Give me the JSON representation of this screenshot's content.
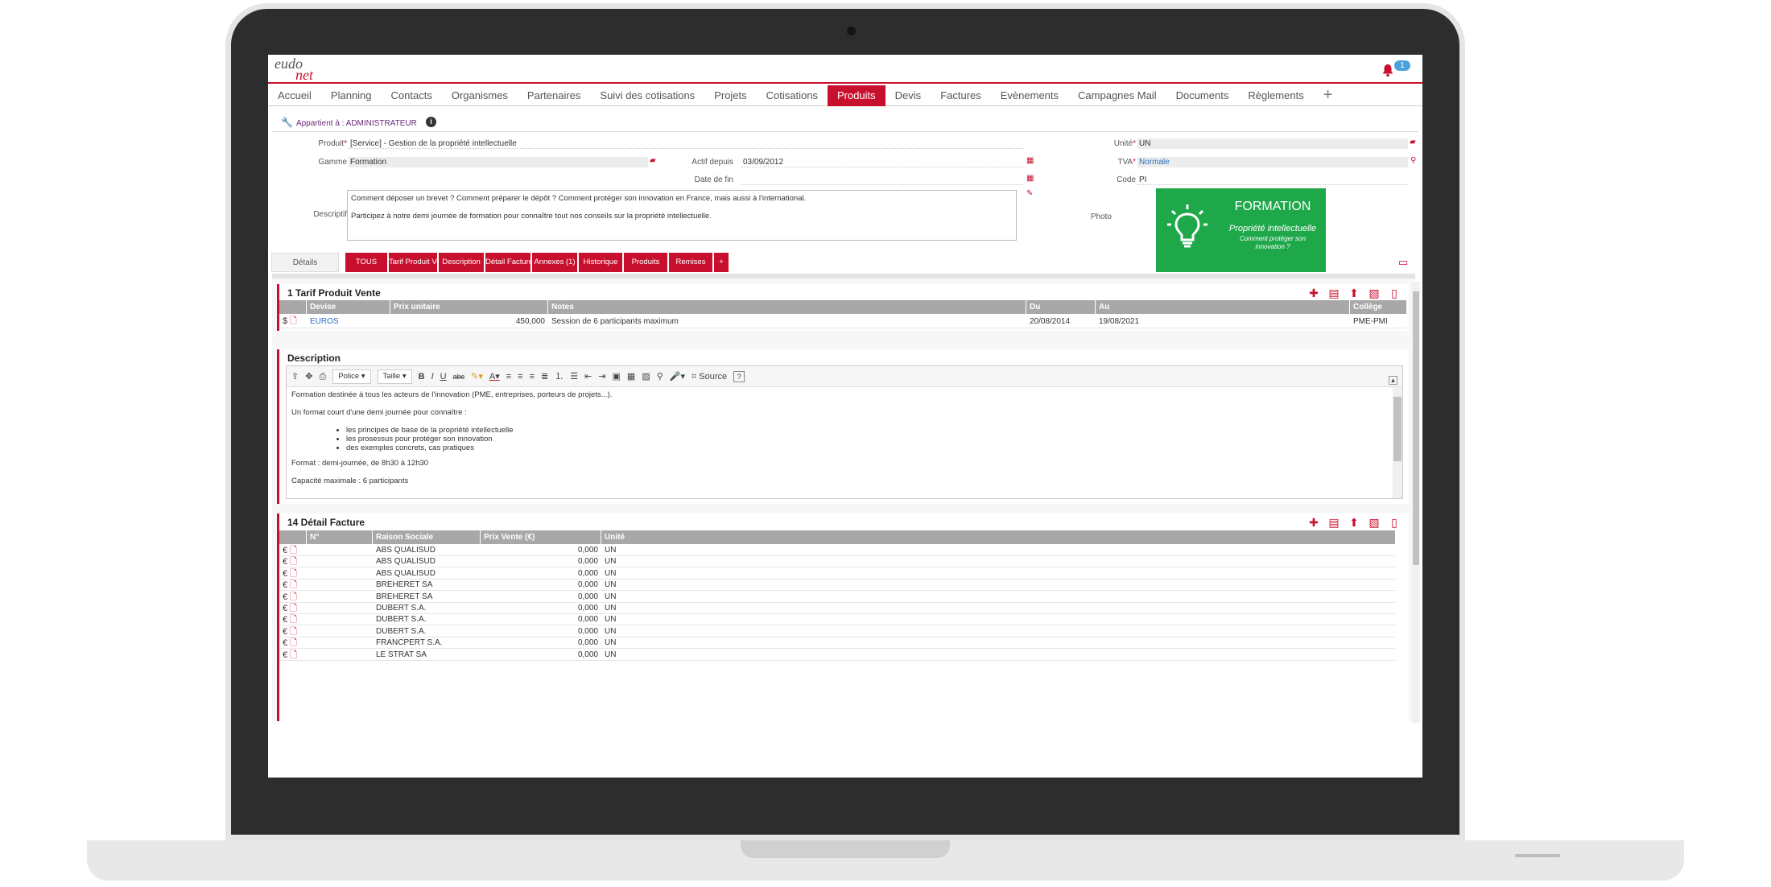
{
  "app": {
    "logo_top": "eudo",
    "logo_bottom": "net",
    "notification_count": "1"
  },
  "nav": {
    "items": [
      "Accueil",
      "Planning",
      "Contacts",
      "Organismes",
      "Partenaires",
      "Suivi des cotisations",
      "Projets",
      "Cotisations",
      "Produits",
      "Devis",
      "Factures",
      "Evènements",
      "Campagnes Mail",
      "Documents",
      "Règlements"
    ],
    "active": "Produits",
    "add": "+"
  },
  "owner": {
    "label": "Appartient à : ADMINISTRATEUR"
  },
  "form": {
    "produit_label": "Produit",
    "produit_value": "[Service] - Gestion de la propriété intellectuelle",
    "gamme_label": "Gamme",
    "gamme_value": "Formation",
    "actif_label": "Actif depuis",
    "actif_value": "03/09/2012",
    "datefin_label": "Date de fin",
    "datefin_value": "",
    "descriptif_label": "Descriptif",
    "descriptif_line1": "Comment déposer un brevet ? Comment préparer le dépôt ? Comment protéger son innovation en France, mais aussi à l'international.",
    "descriptif_line2": "Participez à notre demi journée de formation pour connaître tout nos conseils sur la propriété intellectuelle.",
    "unite_label": "Unité",
    "unite_value": "UN",
    "tva_label": "TVA",
    "tva_value": "Normale",
    "code_label": "Code",
    "code_value": "PI",
    "photo_label": "Photo",
    "photo_title": "FORMATION",
    "photo_subtitle": "Propriété intellectuelle",
    "photo_caption1": "Comment protéger son",
    "photo_caption2": "innovation ?"
  },
  "tabs": {
    "details": "Détails",
    "items": [
      "TOUS",
      "Tarif Produit Vente",
      "Description",
      "Détail Facture",
      "Annexes (1)",
      "Historique",
      "Produits",
      "Remises",
      "+"
    ]
  },
  "tarif": {
    "title": "1 Tarif Produit Vente",
    "columns": [
      "Devise",
      "Prix unitaire",
      "Notes",
      "Du",
      "Au",
      "Collège"
    ],
    "row": {
      "symbol": "$",
      "devise": "EUROS",
      "prix": "450,000",
      "notes": "Session de 6 participants maximum",
      "du": "20/08/2014",
      "au": "19/08/2021",
      "college": "PME-PMI"
    }
  },
  "description": {
    "title": "Description",
    "toolbar": {
      "police": "Police",
      "taille": "Taille",
      "source": "Source",
      "help": "?"
    },
    "p1": "Formation destinée à tous les acteurs de l'innovation (PME, entreprises, porteurs de projets...).",
    "p2": "Un format court d'une demi journée pour connaître :",
    "bullets": [
      "les principes de base de la propriété intellectuelle",
      "les prosessus pour protéger son innovation",
      "des exemples concrets, cas pratiques"
    ],
    "p3": "Format : demi-journée, de 8h30 à 12h30",
    "p4": "Capacité maximale : 6 participants"
  },
  "facture": {
    "title": "14 Détail Facture",
    "columns": [
      "N°",
      "Raison Sociale",
      "Prix Vente (€)",
      "Unité"
    ],
    "rows": [
      {
        "symbol": "€",
        "raison": "ABS QUALISUD",
        "prix": "0,000",
        "unite": "UN"
      },
      {
        "symbol": "€",
        "raison": "ABS QUALISUD",
        "prix": "0,000",
        "unite": "UN"
      },
      {
        "symbol": "€",
        "raison": "ABS QUALISUD",
        "prix": "0,000",
        "unite": "UN"
      },
      {
        "symbol": "€",
        "raison": "BREHERET SA",
        "prix": "0,000",
        "unite": "UN"
      },
      {
        "symbol": "€",
        "raison": "BREHERET SA",
        "prix": "0,000",
        "unite": "UN"
      },
      {
        "symbol": "€",
        "raison": "DUBERT S.A.",
        "prix": "0,000",
        "unite": "UN"
      },
      {
        "symbol": "€",
        "raison": "DUBERT S.A.",
        "prix": "0,000",
        "unite": "UN"
      },
      {
        "symbol": "€",
        "raison": "DUBERT S.A.",
        "prix": "0,000",
        "unite": "UN"
      },
      {
        "symbol": "€",
        "raison": "FRANCPERT S.A.",
        "prix": "0,000",
        "unite": "UN"
      },
      {
        "symbol": "€",
        "raison": "LE STRAT SA",
        "prix": "0,000",
        "unite": "UN"
      }
    ]
  },
  "colors": {
    "brand": "#c8102e",
    "photo_bg": "#1fa84a",
    "header_grey": "#a8a8a8",
    "badge": "#4aa3df"
  }
}
